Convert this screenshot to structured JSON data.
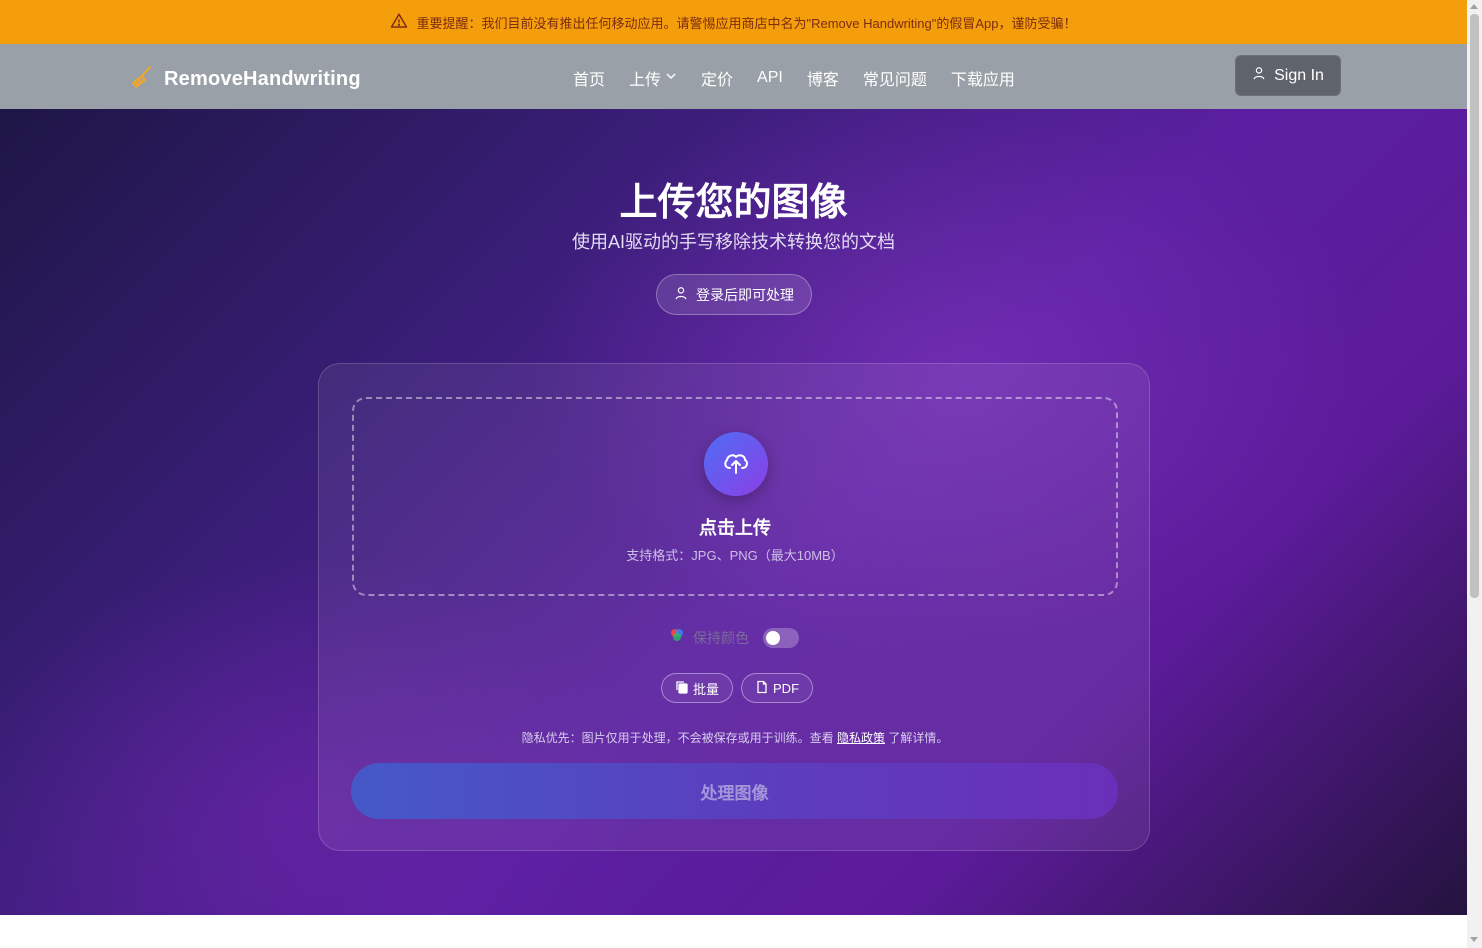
{
  "banner": {
    "text": "重要提醒：我们目前没有推出任何移动应用。请警惕应用商店中名为\"Remove Handwriting\"的假冒App，谨防受骗！",
    "icon": "warning-triangle-icon",
    "color": "#f59e0b"
  },
  "navbar": {
    "brand": "RemoveHandwriting",
    "links": [
      "首页",
      "上传",
      "定价",
      "API",
      "博客",
      "常见问题",
      "下载应用"
    ],
    "signin_label": "Sign In"
  },
  "hero": {
    "title": "上传您的图像",
    "subtitle": "使用AI驱动的手写移除技术转换您的文档",
    "login_label": "登录后即可处理"
  },
  "upload": {
    "label": "点击上传",
    "formats": "支持格式：JPG、PNG（最大10MB）"
  },
  "options": {
    "keep_color_label": "保持颜色",
    "keep_color_enabled": false,
    "batch_label": "批量",
    "pdf_label": "PDF"
  },
  "privacy": {
    "prefix": "隐私优先：图片仅用于处理，不会被保存或用于训练。查看 ",
    "link": "隐私政策",
    "suffix": " 了解详情。"
  },
  "process_label": "处理图像"
}
